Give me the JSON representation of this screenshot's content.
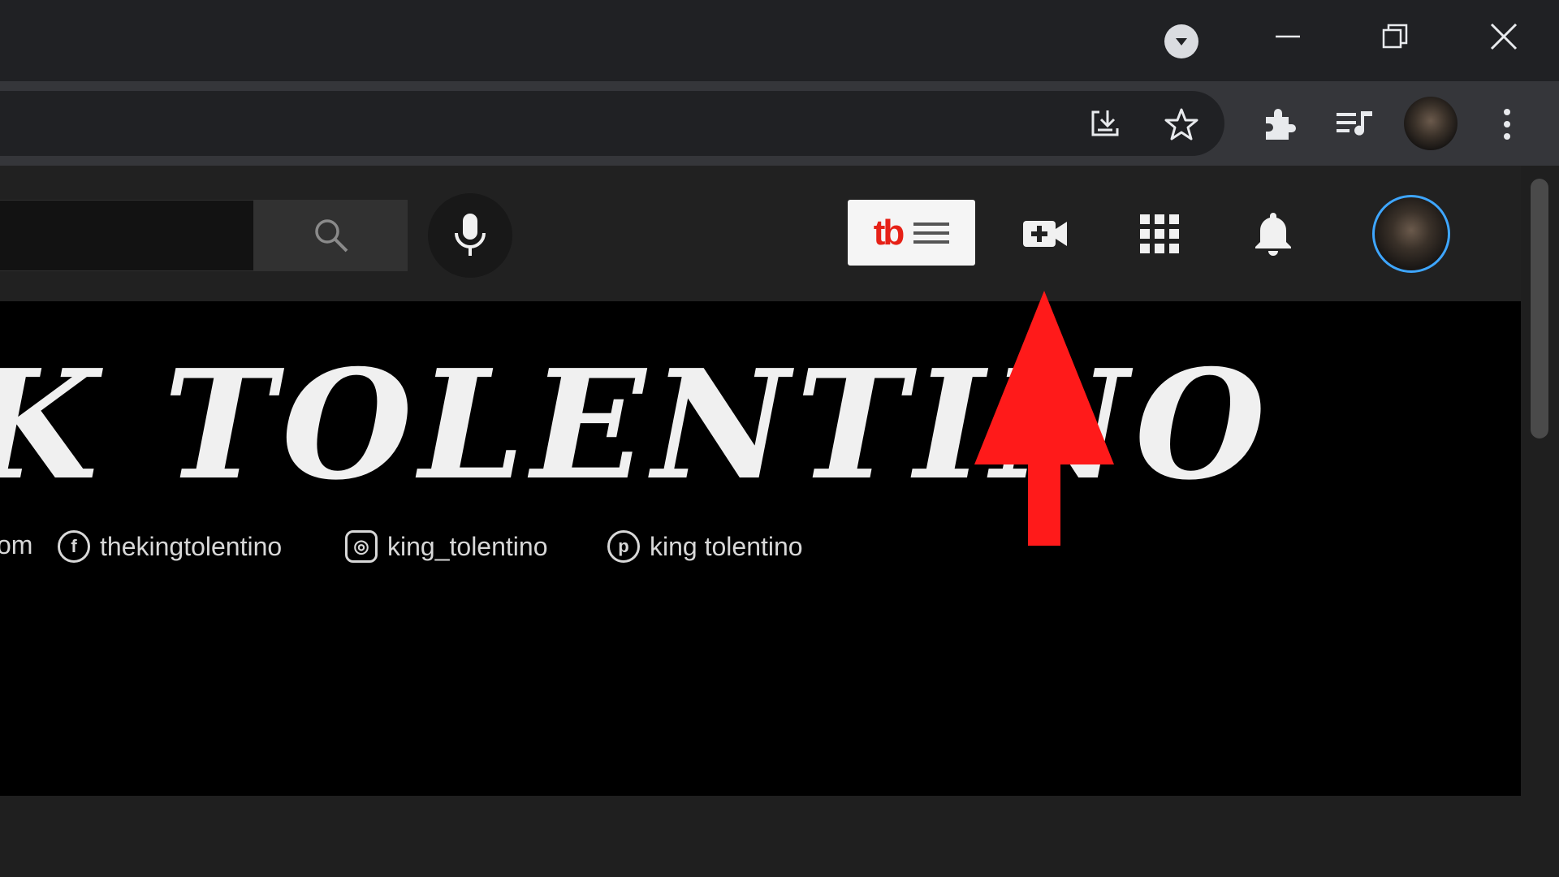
{
  "banner": {
    "title_partial": "TOLENTINO",
    "title_lead": "K",
    "socials": [
      {
        "icon": "website-icon",
        "text": "om"
      },
      {
        "icon": "facebook-icon",
        "text": "thekingtolentino"
      },
      {
        "icon": "instagram-icon",
        "text": "king_tolentino"
      },
      {
        "icon": "pinterest-icon",
        "text": "king tolentino"
      }
    ]
  },
  "tubebuddy": {
    "logo": "tb"
  },
  "colors": {
    "titlebar": "#202124",
    "toolbar": "#35363a",
    "yt_header": "#212121",
    "arrow": "#ff1a1a",
    "avatar_ring": "#3ea6ff",
    "tubebuddy_red": "#e62117"
  },
  "icons": {
    "tab_search": "chevron-down-icon",
    "window": [
      "minimize-icon",
      "restore-icon",
      "close-icon"
    ],
    "toolbar": [
      "install-app-icon",
      "bookmark-star-icon",
      "extensions-puzzle-icon",
      "media-control-icon",
      "profile-avatar",
      "more-vert-icon"
    ],
    "yt_header": [
      "search-icon",
      "mic-icon",
      "create-video-icon",
      "apps-grid-icon",
      "notifications-bell-icon",
      "channel-avatar"
    ]
  }
}
